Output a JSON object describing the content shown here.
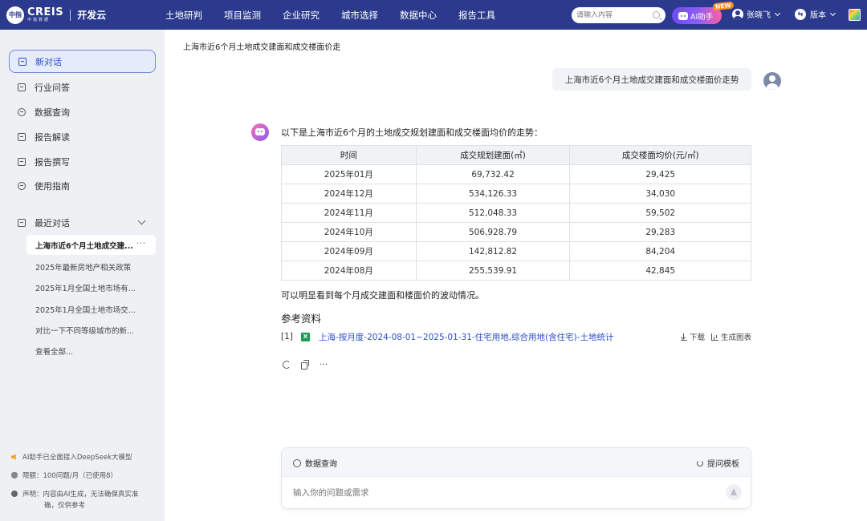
{
  "header": {
    "logo_badge": "中指",
    "brand": "CREIS",
    "brand_sub": "中指数据",
    "product": "开发云",
    "nav": [
      "土地研判",
      "项目监测",
      "企业研究",
      "城市选择",
      "数据中心",
      "报告工具"
    ],
    "search_placeholder": "请输入内容",
    "ai_button": "AI助手",
    "new_tag": "NEW",
    "user_name": "张晓飞",
    "version_label": "版本",
    "version_icon": "⇆"
  },
  "sidebar": {
    "new_chat": "新对话",
    "items": [
      {
        "label": "行业问答",
        "icon": "doc-icon"
      },
      {
        "label": "数据查询",
        "icon": "compass-icon"
      },
      {
        "label": "报告解读",
        "icon": "report-icon"
      },
      {
        "label": "报告撰写",
        "icon": "write-icon"
      },
      {
        "label": "使用指南",
        "icon": "guide-icon"
      }
    ],
    "recent_title": "最近对话",
    "recent_active": "上海市近6个月土地成交建...",
    "recent_active_more": "···",
    "recent": [
      "2025年最新房地产相关政策",
      "2025年1月全国土地市场有...",
      "2025年1月全国土地市场交...",
      "对比一下不同等级城市的新..."
    ],
    "view_all": "查看全部...",
    "footer": {
      "ai_notice": "AI助手已全面接入DeepSeek大模型",
      "quota": "限额：100问题/月（已使用8）",
      "disclaimer_1": "声明：内容由AI生成，无法确保真实准",
      "disclaimer_2": "确，仅供参考"
    }
  },
  "main": {
    "page_title": "上海市近6个月土地成交建面和成交楼面价走",
    "user_message": "上海市近6个月土地成交建面和成交楼面价走势",
    "answer_intro": "以下是上海市近6个月的土地成交规划建面和成交楼面均价的走势：",
    "table": {
      "headers": [
        "时间",
        "成交规划建面(㎡)",
        "成交楼面均价(元/㎡)"
      ],
      "rows": [
        [
          "2025年01月",
          "69,732.42",
          "29,425"
        ],
        [
          "2024年12月",
          "534,126.33",
          "34,030"
        ],
        [
          "2024年11月",
          "512,048.33",
          "59,502"
        ],
        [
          "2024年10月",
          "506,928.79",
          "29,283"
        ],
        [
          "2024年09月",
          "142,812.82",
          "84,204"
        ],
        [
          "2024年08月",
          "255,539.91",
          "42,845"
        ]
      ]
    },
    "answer_outro": "可以明显看到每个月成交建面和楼面价的波动情况。",
    "ref_title": "参考资料",
    "ref_index": "[1]",
    "ref_badge": "X",
    "ref_link": "上海-按月度-2024-08-01~2025-01-31-住宅用地,综合用地(含住宅)-土地统计",
    "ref_download": "下载",
    "ref_chart": "生成图表",
    "more_tool": "···"
  },
  "composer": {
    "mode": "数据查询",
    "templates": "提问模板",
    "placeholder": "输入你的问题或需求"
  },
  "colors": {
    "header_bg": "#2b3a8c",
    "accent": "#2b4fc7",
    "excel_green": "#1f9d55"
  }
}
